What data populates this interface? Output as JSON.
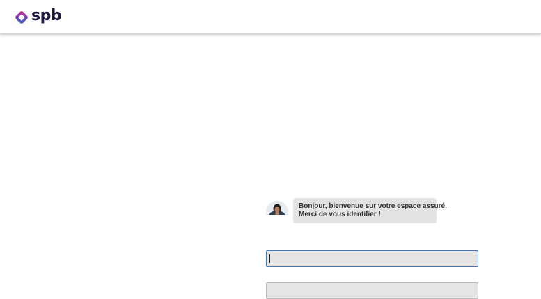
{
  "header": {
    "logo_text": "spb",
    "logo_icon": "spb-diamond-logo",
    "brand_colors": [
      "#1f1a3d",
      "#e0218a",
      "#2a6fd6"
    ]
  },
  "chat": {
    "avatar_icon": "assistant-avatar",
    "message_line1": "Bonjour, bienvenue sur votre espace assuré.",
    "message_line2": "Merci de vous identifier !"
  },
  "form": {
    "identifier_value": "",
    "second_value": ""
  },
  "colors": {
    "input_focus_border": "#4a76b8",
    "bubble_bg": "#e3e3e3"
  }
}
